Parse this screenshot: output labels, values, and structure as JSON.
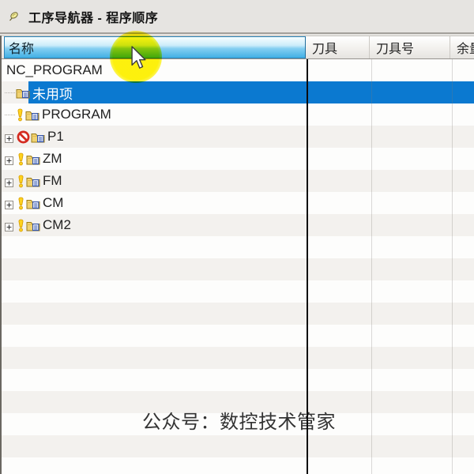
{
  "window": {
    "title": "工序导航器 - 程序顺序",
    "title_icon": "pin-icon"
  },
  "table": {
    "columns": [
      {
        "label": "名称"
      },
      {
        "label": "刀具"
      },
      {
        "label": "刀具号"
      },
      {
        "label": "余量"
      }
    ],
    "rows": [
      {
        "label": "NC_PROGRAM",
        "level": 0,
        "icons": [],
        "expander": false,
        "selected": false
      },
      {
        "label": "未用项",
        "level": 1,
        "icons": [
          "folder"
        ],
        "expander": false,
        "selected": true
      },
      {
        "label": "PROGRAM",
        "level": 1,
        "icons": [
          "warning",
          "folder"
        ],
        "expander": false,
        "selected": false
      },
      {
        "label": "P1",
        "level": 1,
        "icons": [
          "prohibited",
          "folder"
        ],
        "expander": true,
        "selected": false
      },
      {
        "label": "ZM",
        "level": 1,
        "icons": [
          "warning",
          "folder"
        ],
        "expander": true,
        "selected": false
      },
      {
        "label": "FM",
        "level": 1,
        "icons": [
          "warning",
          "folder"
        ],
        "expander": true,
        "selected": false
      },
      {
        "label": "CM",
        "level": 1,
        "icons": [
          "warning",
          "folder"
        ],
        "expander": true,
        "selected": false
      },
      {
        "label": "CM2",
        "level": 1,
        "icons": [
          "warning",
          "folder"
        ],
        "expander": true,
        "selected": false
      }
    ],
    "empty_row_count": 11
  },
  "watermark": {
    "text": "公众号：数控技术管家"
  },
  "colors": {
    "selection": "#0b79d0",
    "selection_text": "#ffffff",
    "name_header_border": "#2b85ba",
    "black_divider": "#0b0b0b",
    "click_highlight": "#fff200",
    "row_stripe": "#f3f1ee"
  }
}
